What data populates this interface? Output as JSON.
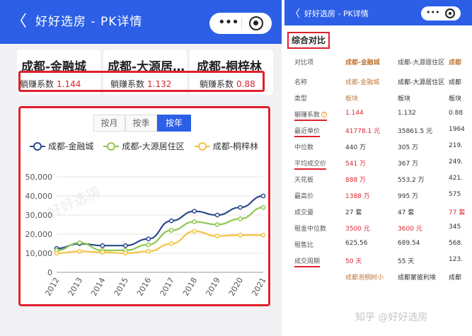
{
  "left": {
    "nav": {
      "back": "〈",
      "title": "好好选房 - PK详情",
      "menu": "•••"
    },
    "cards": [
      {
        "name": "成都-金融城",
        "coef_label": "躺赚系数",
        "coef": "1.144"
      },
      {
        "name": "成都-大源居住区",
        "name_display": "成都-大源居…",
        "coef_label": "躺赚系数",
        "coef": "1.132"
      },
      {
        "name": "成都-桐梓林",
        "coef_label": "躺赚系数",
        "coef": "0.88"
      }
    ],
    "tabs": [
      "按月",
      "按季",
      "按年"
    ],
    "active_tab": "按年",
    "watermark": "好好选房"
  },
  "chart_data": {
    "type": "line",
    "title": "",
    "xlabel": "",
    "ylabel": "",
    "x": [
      "2012",
      "2013",
      "2014",
      "2015",
      "2016",
      "2017",
      "2018",
      "2019",
      "2020",
      "2021"
    ],
    "ylim": [
      0,
      50000
    ],
    "yticks": [
      "0",
      "10,000",
      "20,000",
      "30,000",
      "40,000",
      "50,000"
    ],
    "grid": "horizontal",
    "legend": "top",
    "series": [
      {
        "name": "成都-金融城",
        "color": "#2c4a8c",
        "values": [
          12500,
          15000,
          14000,
          14000,
          17500,
          27000,
          32000,
          30000,
          34000,
          40000
        ]
      },
      {
        "name": "成都-大源居住区",
        "color": "#8ec850",
        "values": [
          11500,
          15500,
          11500,
          11500,
          14500,
          22000,
          26500,
          25000,
          28000,
          34000
        ]
      },
      {
        "name": "成都-桐梓林",
        "color": "#f5c343",
        "values": [
          10000,
          11000,
          10500,
          10000,
          11000,
          15000,
          21500,
          19000,
          19500,
          19500
        ]
      }
    ]
  },
  "right": {
    "nav": {
      "back": "〈",
      "title": "好好选房 - PK详情",
      "menu": "•••"
    },
    "section_title": "综合对比",
    "header": [
      "对比项",
      "成都-金融城",
      "成都-大源居住区",
      "成都"
    ],
    "rows": [
      {
        "label": "名称",
        "v1": "成都-金融城",
        "v2": "成都-大源居住区",
        "v3": "成都"
      },
      {
        "label": "类型",
        "v1": "板块",
        "v2": "板块",
        "v3": "板块"
      },
      {
        "label": "躺赚系数",
        "v1": "1.144",
        "v2": "1.132",
        "v3": "0.88"
      },
      {
        "label": "最近单价",
        "v1": "41778.1 元",
        "v2": "35861.5 元",
        "v3": "1964"
      },
      {
        "label": "中位数",
        "v1": "440 万",
        "v2": "305 万",
        "v3": "219."
      },
      {
        "label": "平均成交价",
        "v1": "541 万",
        "v2": "367 万",
        "v3": "249."
      },
      {
        "label": "天花板",
        "v1": "888 万",
        "v2": "553.2 万",
        "v3": "421."
      },
      {
        "label": "最高价",
        "v1": "1388 万",
        "v2": "995 万",
        "v3": "575"
      },
      {
        "label": "成交量",
        "v1": "27 套",
        "v2": "47 套",
        "v3": "77 套"
      },
      {
        "label": "租金中位数",
        "v1": "3500 元",
        "v2": "3600 元",
        "v3": "345"
      },
      {
        "label": "租售比",
        "v1": "625.56",
        "v2": "689.54",
        "v3": "568."
      },
      {
        "label": "成交周期",
        "v1": "50 天",
        "v2": "55 天",
        "v3": "123."
      },
      {
        "label": "",
        "v1": "成都泡桐树小",
        "v2": "成都蒙彼利埃",
        "v3": "成都"
      }
    ],
    "footer": "知乎 @好好选房"
  }
}
